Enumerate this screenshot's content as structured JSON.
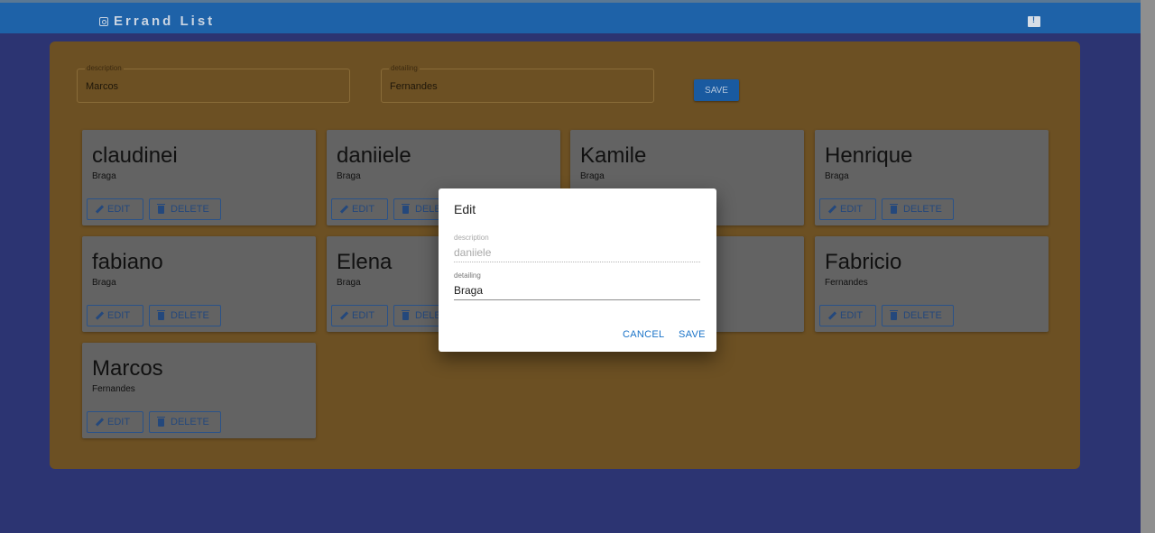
{
  "app": {
    "title": "Errand List",
    "title_icon": "camera-icon",
    "feedback_icon": "feedback-icon"
  },
  "form": {
    "description": {
      "label": "description",
      "value": "Marcos"
    },
    "detailing": {
      "label": "detailing",
      "value": "Fernandes"
    },
    "save_label": "SAVE"
  },
  "cards": [
    {
      "title": "claudinei",
      "subtitle": "Braga"
    },
    {
      "title": "daniiele",
      "subtitle": "Braga"
    },
    {
      "title": "Kamile",
      "subtitle": "Braga"
    },
    {
      "title": "Henrique",
      "subtitle": "Braga"
    },
    {
      "title": "fabiano",
      "subtitle": "Braga"
    },
    {
      "title": "Elena",
      "subtitle": "Braga"
    },
    {
      "title": "",
      "subtitle": ""
    },
    {
      "title": "Fabricio",
      "subtitle": "Fernandes"
    },
    {
      "title": "Marcos",
      "subtitle": "Fernandes"
    }
  ],
  "card_buttons": {
    "edit_label": "EDIT",
    "delete_label": "DELETE",
    "edit_icon": "pencil-icon",
    "delete_icon": "trash-icon"
  },
  "dialog": {
    "title": "Edit",
    "description": {
      "label": "description",
      "value": "daniiele",
      "disabled": true
    },
    "detailing": {
      "label": "detailing",
      "value": "Braga"
    },
    "cancel_label": "CANCEL",
    "save_label": "SAVE"
  },
  "colors": {
    "appbar": "#1e62a8",
    "background": "#2c3472",
    "panel": "#6c5023",
    "card": "#636363",
    "primary_button": "#195aa0",
    "dialog_action": "#1a73c8"
  }
}
